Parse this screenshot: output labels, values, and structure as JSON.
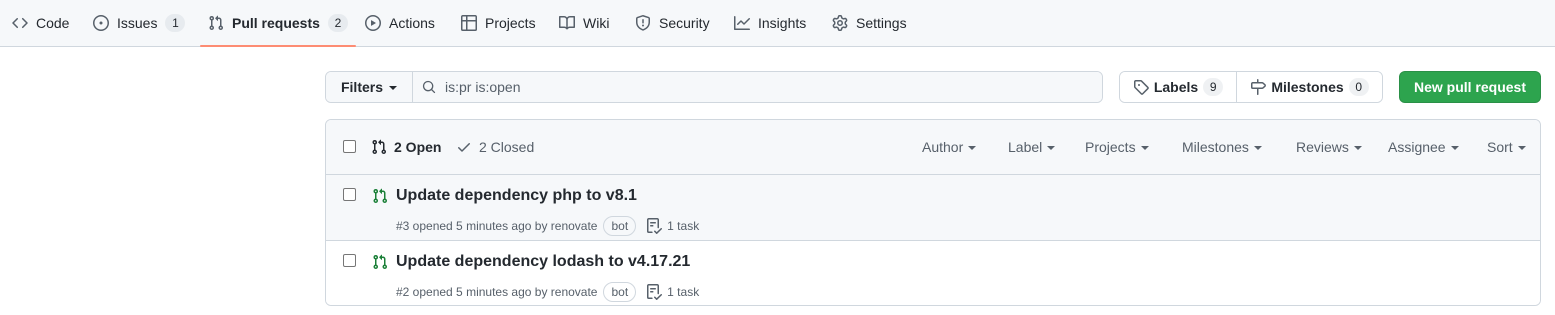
{
  "nav": {
    "items": [
      {
        "label": "Code",
        "icon": "code-icon"
      },
      {
        "label": "Issues",
        "icon": "issue-opened-icon",
        "count": "1"
      },
      {
        "label": "Pull requests",
        "icon": "git-pull-request-icon",
        "count": "2",
        "active": true
      },
      {
        "label": "Actions",
        "icon": "play-icon"
      },
      {
        "label": "Projects",
        "icon": "table-icon"
      },
      {
        "label": "Wiki",
        "icon": "book-icon"
      },
      {
        "label": "Security",
        "icon": "shield-icon"
      },
      {
        "label": "Insights",
        "icon": "graph-icon"
      },
      {
        "label": "Settings",
        "icon": "gear-icon"
      }
    ]
  },
  "toolbar": {
    "filters_label": "Filters",
    "search_value": "is:pr is:open",
    "labels_label": "Labels",
    "labels_count": "9",
    "milestones_label": "Milestones",
    "milestones_count": "0",
    "new_pr_label": "New pull request"
  },
  "list": {
    "open_label": "2 Open",
    "closed_label": "2 Closed",
    "filters": [
      "Author",
      "Label",
      "Projects",
      "Milestones",
      "Reviews",
      "Assignee",
      "Sort"
    ],
    "rows": [
      {
        "title": "Update dependency php to v8.1",
        "meta": "#3 opened 5 minutes ago by renovate",
        "badge": "bot",
        "task": "1 task"
      },
      {
        "title": "Update dependency lodash to v4.17.21",
        "meta": "#2 opened 5 minutes ago by renovate",
        "badge": "bot",
        "task": "1 task"
      }
    ]
  },
  "colors": {
    "accent_underline": "#fd8c73",
    "primary_button": "#2da44e",
    "open_pr_icon": "#1a7f37"
  }
}
